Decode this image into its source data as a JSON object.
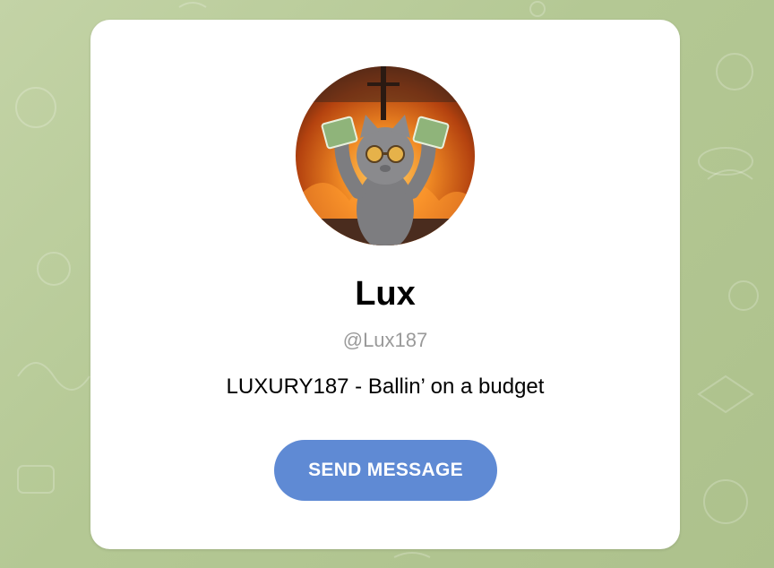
{
  "profile": {
    "name": "Lux",
    "username": "@Lux187",
    "bio": "LUXURY187 - Ballin’ on a budget",
    "avatar_icon": "cat-with-money-avatar"
  },
  "actions": {
    "send_message_label": "SEND MESSAGE"
  },
  "colors": {
    "background": "#b9cb9c",
    "card": "#ffffff",
    "button": "#5f8ad4",
    "username": "#9a9a9a"
  }
}
